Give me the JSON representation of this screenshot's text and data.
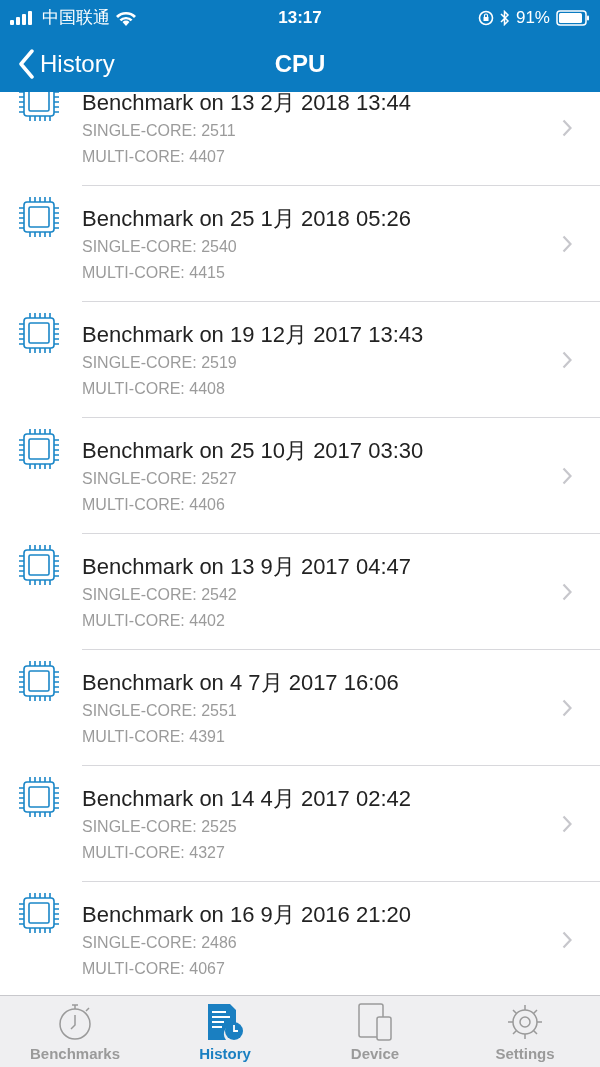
{
  "status_bar": {
    "carrier": "中国联通",
    "time": "13:17",
    "battery": "91%"
  },
  "nav": {
    "back": "History",
    "title": "CPU"
  },
  "rows": [
    {
      "title": "Benchmark on 13 2月 2018 13:44",
      "single": "SINGLE-CORE: 2511",
      "multi": "MULTI-CORE: 4407"
    },
    {
      "title": "Benchmark on 25 1月 2018 05:26",
      "single": "SINGLE-CORE: 2540",
      "multi": "MULTI-CORE: 4415"
    },
    {
      "title": "Benchmark on 19 12月 2017 13:43",
      "single": "SINGLE-CORE: 2519",
      "multi": "MULTI-CORE: 4408"
    },
    {
      "title": "Benchmark on 25 10月 2017 03:30",
      "single": "SINGLE-CORE: 2527",
      "multi": "MULTI-CORE: 4406"
    },
    {
      "title": "Benchmark on 13 9月 2017 04:47",
      "single": "SINGLE-CORE: 2542",
      "multi": "MULTI-CORE: 4402"
    },
    {
      "title": "Benchmark on 4 7月 2017 16:06",
      "single": "SINGLE-CORE: 2551",
      "multi": "MULTI-CORE: 4391"
    },
    {
      "title": "Benchmark on 14 4月 2017 02:42",
      "single": "SINGLE-CORE: 2525",
      "multi": "MULTI-CORE: 4327"
    },
    {
      "title": "Benchmark on 16 9月 2016 21:20",
      "single": "SINGLE-CORE: 2486",
      "multi": "MULTI-CORE: 4067"
    }
  ],
  "tabs": [
    {
      "kind": "stopwatch",
      "label": "Benchmarks",
      "selected": false
    },
    {
      "kind": "history",
      "label": "History",
      "selected": true
    },
    {
      "kind": "device",
      "label": "Device",
      "selected": false
    },
    {
      "kind": "settings",
      "label": "Settings",
      "selected": false
    }
  ]
}
